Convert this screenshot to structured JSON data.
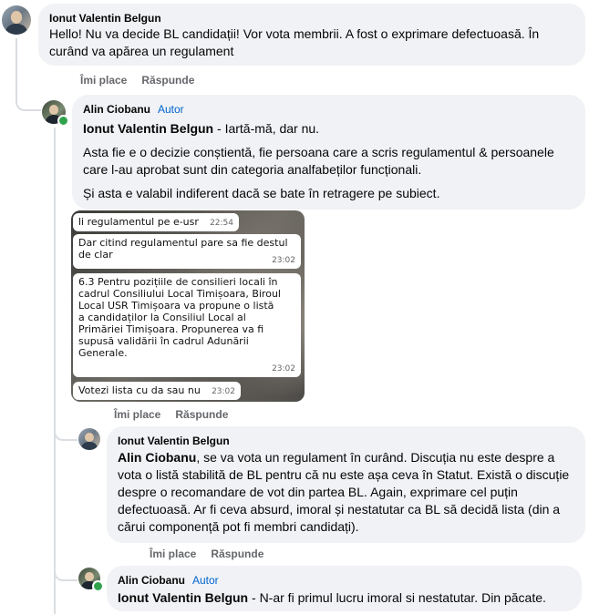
{
  "comment1": {
    "author": "Ionut Valentin Belgun",
    "text": "Hello! Nu va decide BL candidații! Vor vota membrii. A fost o exprimare defectuoasă. În curând va apărea un regulament",
    "actions": {
      "like": "Îmi place",
      "reply": "Răspunde"
    }
  },
  "reply1": {
    "author": "Alin Ciobanu",
    "badge": "Autor",
    "mention": "Ionut Valentin Belgun",
    "p1_rest": " - Iartă-mă, dar nu.",
    "p2": "Asta fie e o decizie conștientă, fie persoana care a scris regulamentul & persoanele care l-au aprobat sunt din categoria analfabeților funcționali.",
    "p3": "Și asta e valabil indiferent dacă se bate în retragere pe subiect.",
    "actions": {
      "like": "Îmi place",
      "reply": "Răspunde"
    },
    "image": {
      "messages": [
        {
          "text": "li regulamentul pe e-usr",
          "time": "22:54"
        },
        {
          "text": "Dar citind regulamentul pare sa fie destul de clar",
          "time": "23:02"
        },
        {
          "text": "6.3 Pentru pozițiile de consilieri locali în cadrul Consiliului Local Timișoara, Biroul Local USR Timișoara va propune o listă a candidaților la Consiliul Local al Primăriei Timișoara. Propunerea va fi supusă validării în cadrul Adunării Generale.",
          "time": "23:02"
        },
        {
          "text": "Votezi lista cu da sau nu",
          "time": "23:02"
        }
      ]
    }
  },
  "reply2": {
    "author": "Ionut Valentin Belgun",
    "mention": "Alin Ciobanu",
    "text_rest": ", se va vota un regulament în curând. Discuția nu este despre a vota o listă stabilită de BL pentru că nu este așa ceva în Statut. Există o discuție despre o recomandare de vot din partea BL. Again, exprimare cel puțin defectuoasă. Ar fi ceva absurd, imoral și nestatutar ca BL să decidă lista (din a cărui componență pot fi membri candidați).",
    "actions": {
      "like": "Îmi place",
      "reply": "Răspunde"
    }
  },
  "reply3": {
    "author": "Alin Ciobanu",
    "badge": "Autor",
    "mention": "Ionut Valentin Belgun",
    "text_rest": " - N-ar fi primul lucru imoral si nestatutar. Din păcate."
  }
}
